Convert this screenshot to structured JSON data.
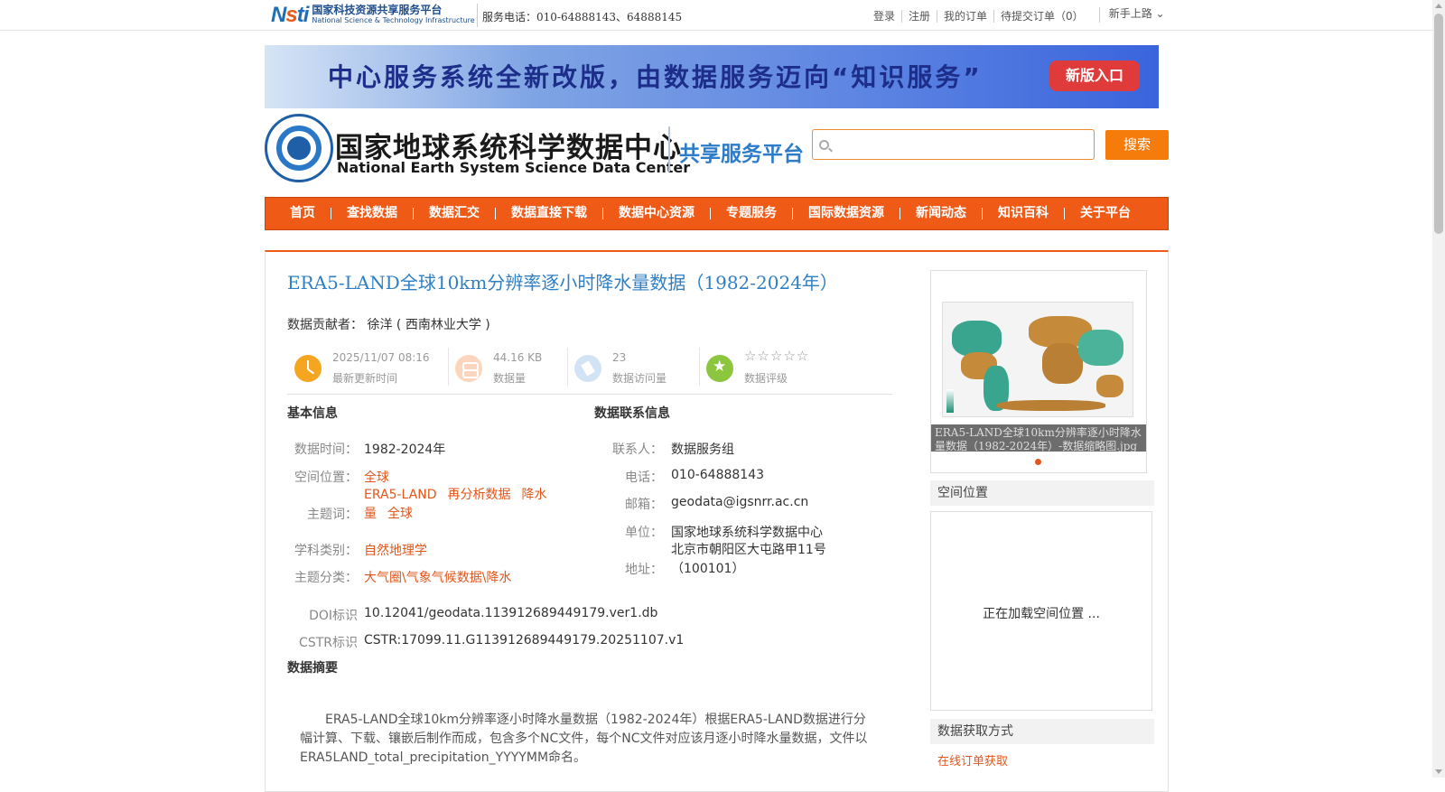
{
  "topbar": {
    "logo_cn": "国家科技资源共享服务平台",
    "logo_en": "National Science & Technology Infrastructure",
    "phone": "服务电话：010-64888143、64888145",
    "links": [
      "登录",
      "注册",
      "我的订单",
      "待提交订单（0）"
    ],
    "newbie": "新手上路"
  },
  "banner": {
    "text": "中心服务系统全新改版，由数据服务迈向“知识服务”",
    "button": "新版入口"
  },
  "header": {
    "name_cn": "国家地球系统科学数据中心",
    "name_en": "National Earth System Science Data Center",
    "platform": "共享服务平台",
    "search_placeholder": "",
    "search_button": "搜索"
  },
  "nav": [
    "首页",
    "查找数据",
    "数据汇交",
    "数据直接下载",
    "数据中心资源",
    "专题服务",
    "国际数据资源",
    "新闻动态",
    "知识百科",
    "关于平台"
  ],
  "dataset": {
    "title": "ERA5-LAND全球10km分辨率逐小时降水量数据（1982-2024年）",
    "contributor_label": "数据贡献者：",
    "contributor": "徐洋 ( 西南林业大学 )",
    "stats": {
      "updated_value": "2025/11/07 08:16",
      "updated_label": "最新更新时间",
      "size_value": "44.16 KB",
      "size_label": "数据量",
      "visits_value": "23",
      "visits_label": "数据访问量",
      "rating_label": "数据评级",
      "rating_stars": 0
    }
  },
  "basic_info": {
    "heading": "基本信息",
    "time_label": "数据时间：",
    "time_value": "1982-2024年",
    "space_label": "空间位置：",
    "space_value": "全球",
    "keywords_label": "主题词：",
    "keywords": [
      "ERA5-LAND",
      "再分析数据",
      "降水",
      "量",
      "全球"
    ],
    "discipline_label": "学科类别：",
    "discipline_value": "自然地理学",
    "category_label": "主题分类：",
    "category_value": "大气圈\\气象气候数据\\降水",
    "doi_label": "DOI标识",
    "doi_value": "10.12041/geodata.113912689449179.ver1.db",
    "cstr_label": "CSTR标识",
    "cstr_value": "CSTR:17099.11.G113912689449179.20251107.v1"
  },
  "contact_info": {
    "heading": "数据联系信息",
    "contact_label": "联系人：",
    "contact_value": "数据服务组",
    "phone_label": "电话：",
    "phone_value": "010-64888143",
    "email_label": "邮箱：",
    "email_value": "geodata@igsnrr.ac.cn",
    "unit_label": "单位：",
    "unit_value": "国家地球系统科学数据中心",
    "address_label": "地址：",
    "address_line1": "北京市朝阳区大屯路甲11号",
    "address_line2": "（100101）"
  },
  "abstract": {
    "heading": "数据摘要",
    "text": "ERA5-LAND全球10km分辨率逐小时降水量数据（1982-2024年）根据ERA5-LAND数据进行分幅计算、下载、镶嵌后制作而成，包含多个NC文件，每个NC文件对应该月逐小时降水量数据，文件以ERA5LAND_total_precipitation_YYYYMM命名。"
  },
  "sidebar": {
    "thumb_caption": "ERA5-LAND全球10km分辨率逐小时降水量数据（1982-2024年）-数据缩略图.jpg",
    "spatial_heading": "空间位置",
    "spatial_loading": "正在加载空间位置 ...",
    "access_heading": "数据获取方式",
    "access_link": "在线订单获取"
  },
  "colors": {
    "accent": "#ef5a17",
    "title_blue": "#2f7fc4",
    "link_orange": "#e2561b"
  }
}
